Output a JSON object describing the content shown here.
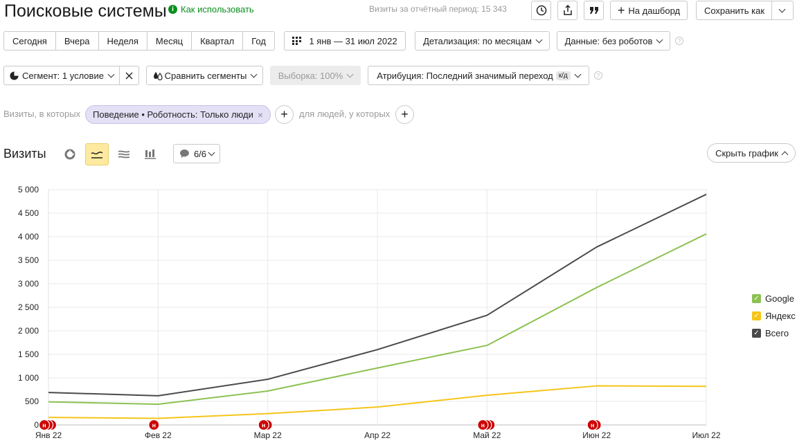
{
  "header": {
    "title": "Поисковые системы",
    "howto": "Как использовать",
    "period_label": "Визиты за отчётный период: 15 343",
    "dashboard_button": "На дашборд",
    "save_button": "Сохранить как"
  },
  "toolbar": {
    "periods": [
      "Сегодня",
      "Вчера",
      "Неделя",
      "Месяц",
      "Квартал",
      "Год"
    ],
    "date_range": "1 янв — 31 июл 2022",
    "detail": "Детализация: по месяцам",
    "data_filter": "Данные: без роботов"
  },
  "segment_bar": {
    "segment": "Сегмент: 1 условие",
    "compare": "Сравнить сегменты",
    "sample": "Выборка: 100%",
    "attribution": "Атрибуция: Последний значимый переход",
    "attribution_badge": "к/д"
  },
  "filter_bar": {
    "visits_label": "Визиты, в которых",
    "chip": "Поведение • Роботность: Только люди",
    "people_label": "для людей, у которых"
  },
  "chart_header": {
    "title": "Визиты",
    "series_count": "6/6",
    "hide_button": "Скрыть график"
  },
  "annotation_marker": "н",
  "colors": {
    "accent_green": "#0a8f1f",
    "google": "#8cc152",
    "yandex": "#f5c518",
    "total": "#4a4a4a",
    "marker": "#cc0000"
  },
  "chart_data": {
    "type": "line",
    "categories": [
      "Янв 22",
      "Фев 22",
      "Мар 22",
      "Апр 22",
      "Май 22",
      "Июн 22",
      "Июл 22"
    ],
    "ylim": [
      0,
      5000
    ],
    "yticks": [
      "0",
      "500",
      "1 000",
      "1 500",
      "2 000",
      "2 500",
      "3 000",
      "3 500",
      "4 000",
      "4 500",
      "5 000"
    ],
    "series": [
      {
        "name": "Google",
        "color": "#8cc152",
        "values": [
          490,
          440,
          720,
          1210,
          1690,
          2920,
          4060
        ]
      },
      {
        "name": "Яндекс",
        "color": "#f5c518",
        "values": [
          160,
          140,
          240,
          380,
          630,
          830,
          820
        ]
      },
      {
        "name": "Всего",
        "color": "#4a4a4a",
        "values": [
          690,
          620,
          970,
          1600,
          2330,
          3780,
          4900
        ]
      }
    ],
    "markers": [
      {
        "category": "Янв 22",
        "count": 3
      },
      {
        "category": "Фев 22",
        "count": 1
      },
      {
        "category": "Мар 22",
        "count": 2
      },
      {
        "category": "Май 22",
        "count": 3
      },
      {
        "category": "Июн 22",
        "count": 2
      }
    ],
    "grid": true,
    "legend_position": "right"
  }
}
